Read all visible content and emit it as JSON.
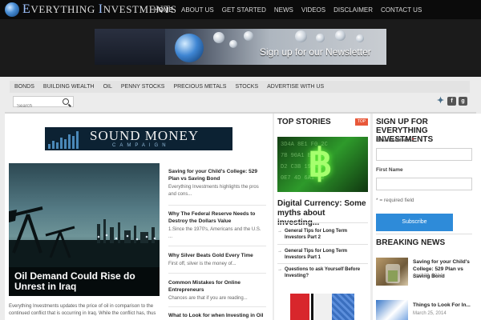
{
  "site": {
    "logo_first": "E",
    "logo_rest": "VERYTHING ",
    "logo_second": "I",
    "logo_rest2": "NVESTMENTS"
  },
  "nav": [
    "HOME",
    "ABOUT US",
    "GET STARTED",
    "NEWS",
    "VIDEOS",
    "DISCLAIMER",
    "CONTACT US"
  ],
  "newsletter_banner": {
    "text": "Sign up for our Newsletter"
  },
  "categories": [
    "BONDS",
    "BUILDING WEALTH",
    "OIL",
    "PENNY STOCKS",
    "PRECIOUS METALS",
    "STOCKS",
    "ADVERTISE WITH US"
  ],
  "search": {
    "placeholder": "Search"
  },
  "ad_banner": {
    "title": "SOUND MONEY",
    "subtitle": "CAMPAIGN"
  },
  "featured": {
    "title": "Oil Demand Could Rise do Unrest in Iraq",
    "excerpt": "Everything Investments updates the price of oil in comparison to the continued conflict that is occurring in Iraq. While the conflict has, thus"
  },
  "side_articles": [
    {
      "title": "Saving for your Child's College: 529 Plan vs Saving Bond",
      "excerpt": "Everything Investments highlights the pros and cons..."
    },
    {
      "title": "Why The Federal Reserve Needs to Destroy the Dollars Value",
      "excerpt": "1.Since the 1970's, Americans and the U.S. ..."
    },
    {
      "title": "Why Silver Beats Gold Every Time",
      "excerpt": "First off, silver is the money of..."
    },
    {
      "title": "Common Mistakes for Online Entrepreneurs",
      "excerpt": "Chances are that if you are reading..."
    },
    {
      "title": "What to Look for when Investing in Oil",
      "excerpt": ""
    }
  ],
  "top_stories": {
    "heading": "TOP STORIES",
    "badge": "TOP",
    "main_title": "Digital Currency: Some myths about investing...",
    "links": [
      "General Tips for Long Term Investors Part 2",
      "General Tips for Long Term Investors Part 1",
      "Questions to ask Yourself Before Investing?"
    ]
  },
  "signup": {
    "heading": "SIGN UP FOR EVERYTHING INVESTMENTS",
    "email_label": "Email Address",
    "required_mark": "*",
    "first_name_label": "First Name",
    "required_note": "* = required field",
    "button": "Subscribe"
  },
  "breaking_news": {
    "heading": "BREAKING NEWS",
    "items": [
      {
        "title": "Saving for your Child's College: 529 Plan vs Saving Bond",
        "date": "April 20, 2014"
      },
      {
        "title": "Things to Look For In...",
        "date": "March 25, 2014"
      }
    ]
  },
  "colors": {
    "nav_bg": "#0b0b0b",
    "badge": "#e8583a",
    "subscribe": "#2e8bd9",
    "twitter": "#55acee",
    "facebook": "#3b5998",
    "google": "#dd4b39"
  }
}
